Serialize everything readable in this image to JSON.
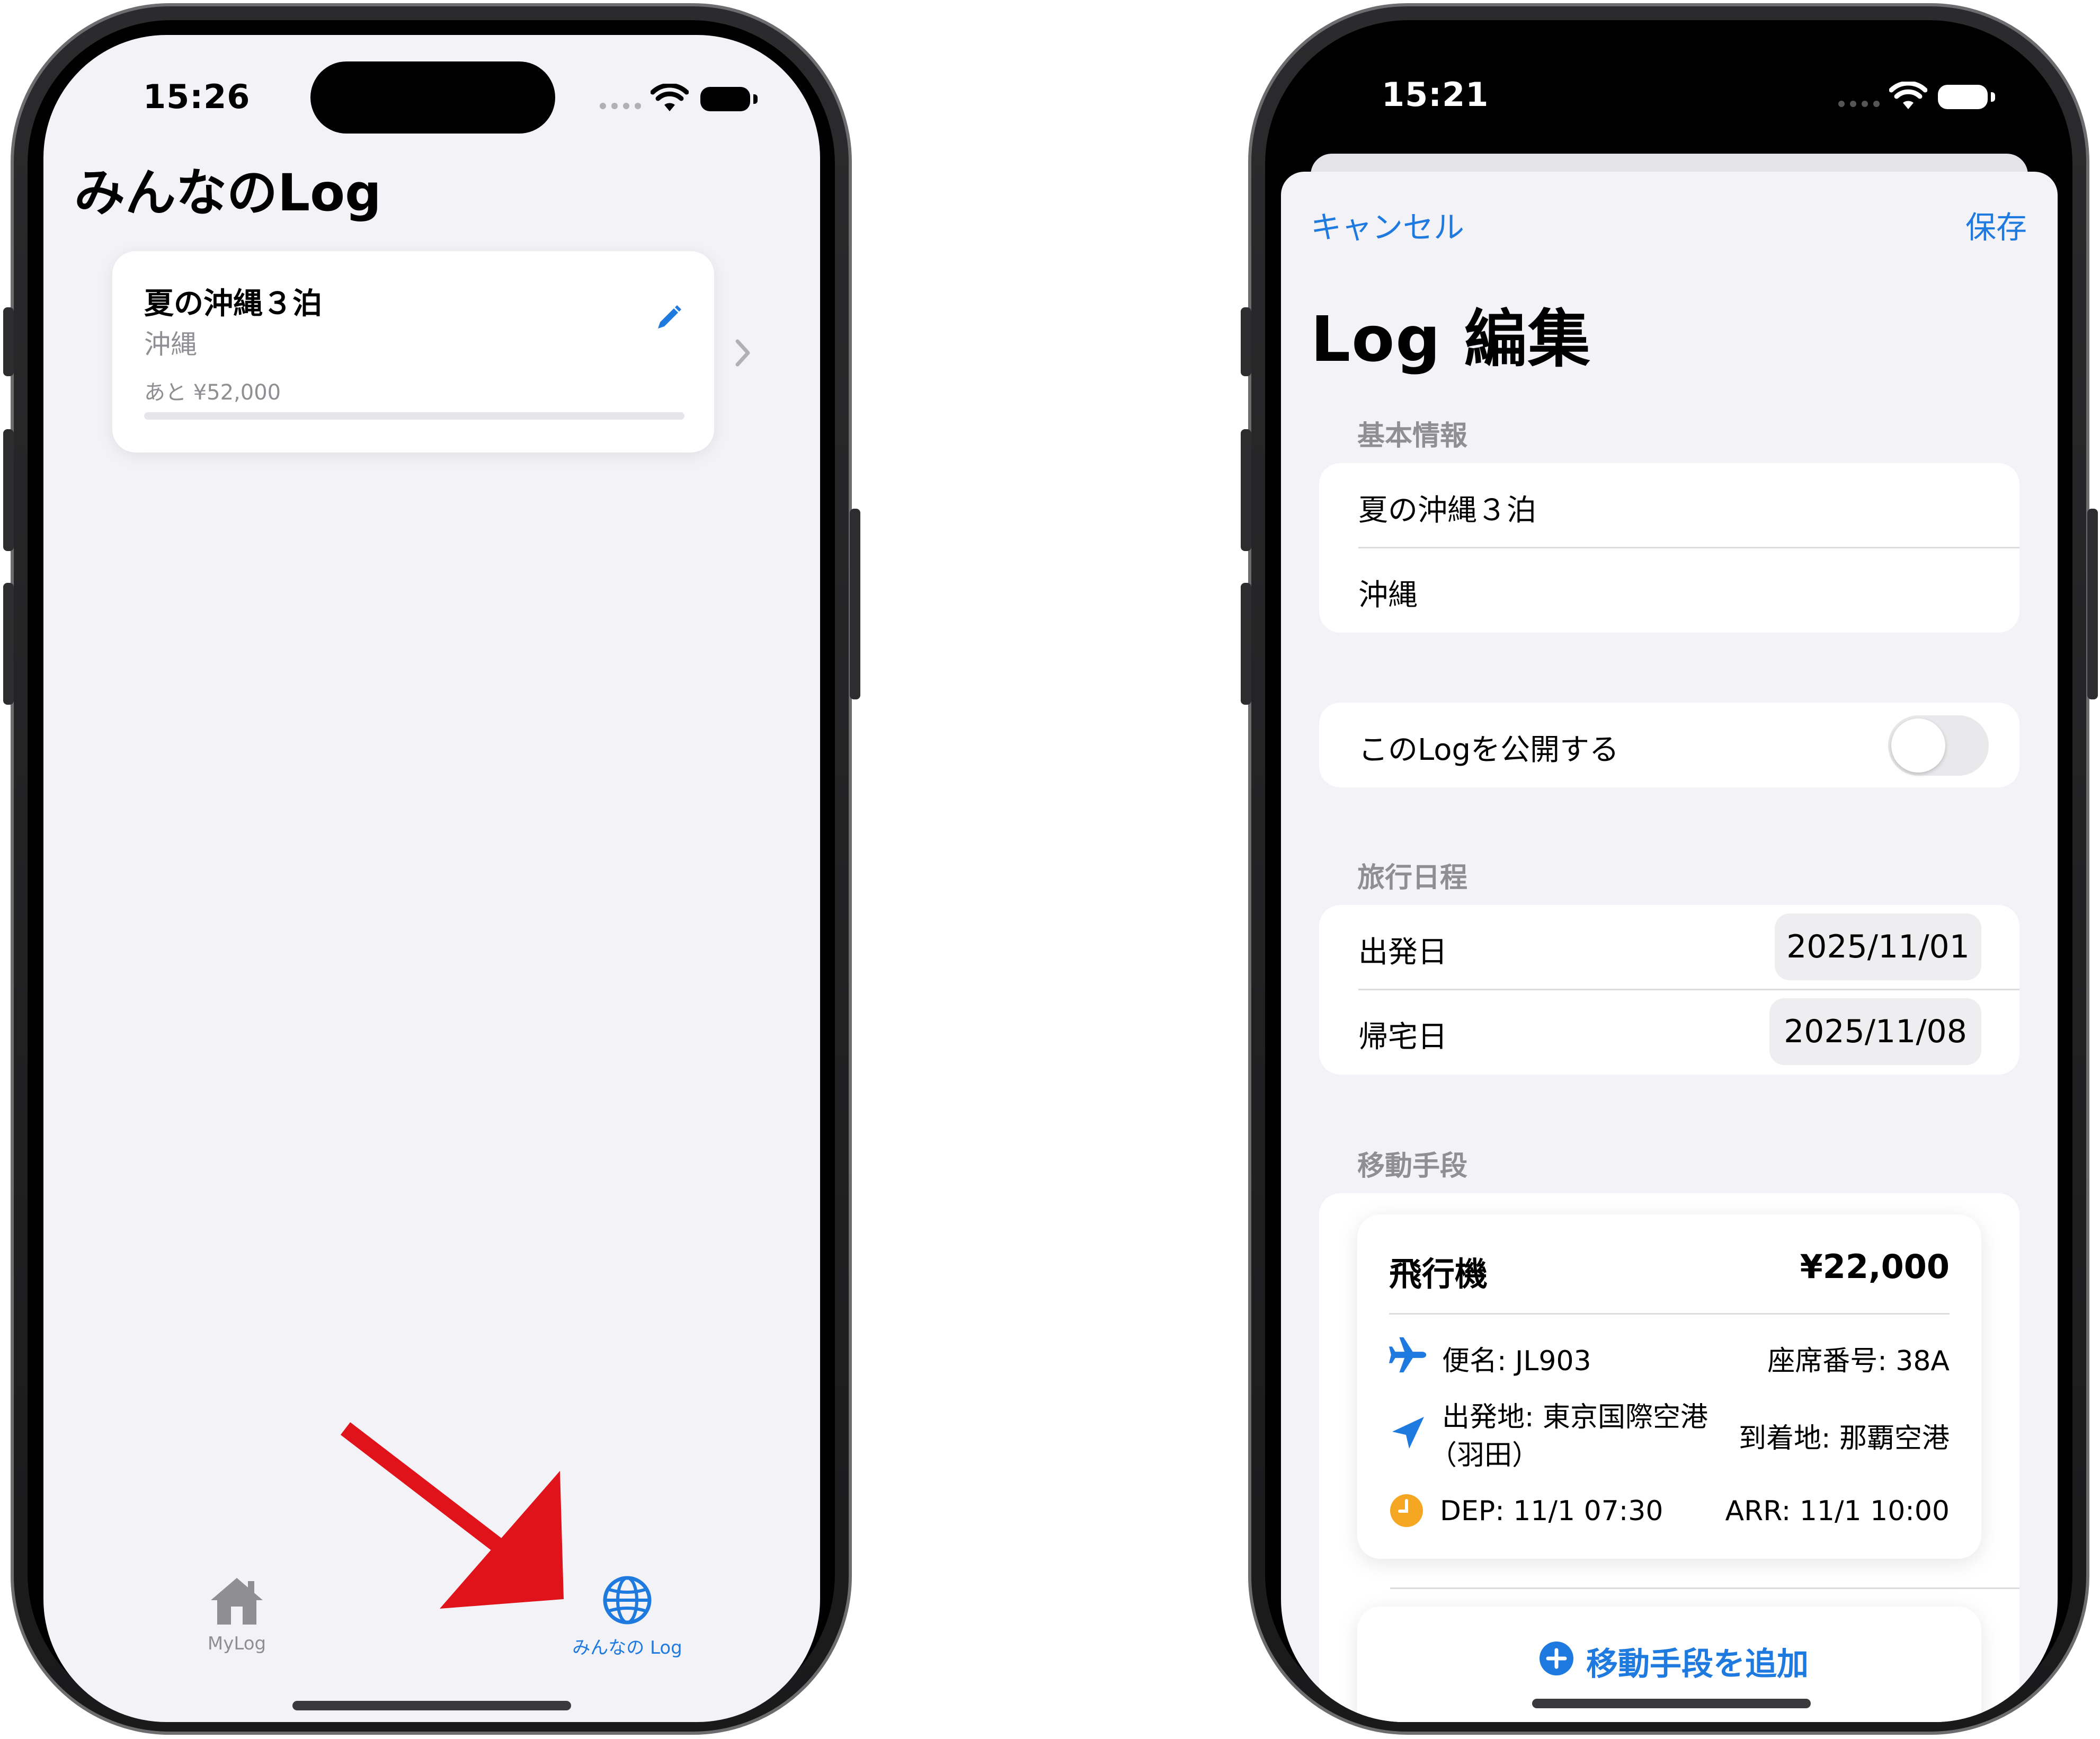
{
  "left": {
    "status": {
      "time": "15:26"
    },
    "title": "みんなのLog",
    "card": {
      "title": "夏の沖縄３泊",
      "subtitle": "沖縄",
      "remaining": "あと ¥52,000",
      "progress_fraction": 0.0
    },
    "tabs": [
      {
        "label": "MyLog",
        "icon": "house-icon",
        "selected": false
      },
      {
        "label": "みんなの Log",
        "icon": "globe-icon",
        "selected": true
      }
    ],
    "annotation_arrow": {
      "color": "#e0121a",
      "icon": "arrow-pointer-icon"
    }
  },
  "right": {
    "status": {
      "time": "15:21"
    },
    "nav": {
      "cancel": "キャンセル",
      "save": "保存"
    },
    "title": "Log 編集",
    "basic_info": {
      "header": "基本情報",
      "title_value": "夏の沖縄３泊",
      "destination_value": "沖縄"
    },
    "publish": {
      "label": "このLogを公開する",
      "enabled": false
    },
    "schedule": {
      "header": "旅行日程",
      "departure_label": "出発日",
      "departure_value": "2025/11/01",
      "return_label": "帰宅日",
      "return_value": "2025/11/08"
    },
    "transport": {
      "header": "移動手段",
      "item": {
        "type": "飛行機",
        "price": "¥22,000",
        "flight": "便名: JL903",
        "seat": "座席番号: 38A",
        "from_line1": "出発地: 東京国際空港",
        "from_line2": "（羽田）",
        "to": "到着地: 那覇空港",
        "dep": "DEP: 11/1 07:30",
        "arr": "ARR: 11/1 10:00"
      },
      "add_label": "移動手段を追加"
    }
  },
  "colors": {
    "accent": "#1f7ae0",
    "background": "#f2f2f7",
    "secondary_text": "#8e8e93",
    "clock_icon": "#f5a623",
    "arrow": "#e0121a"
  }
}
